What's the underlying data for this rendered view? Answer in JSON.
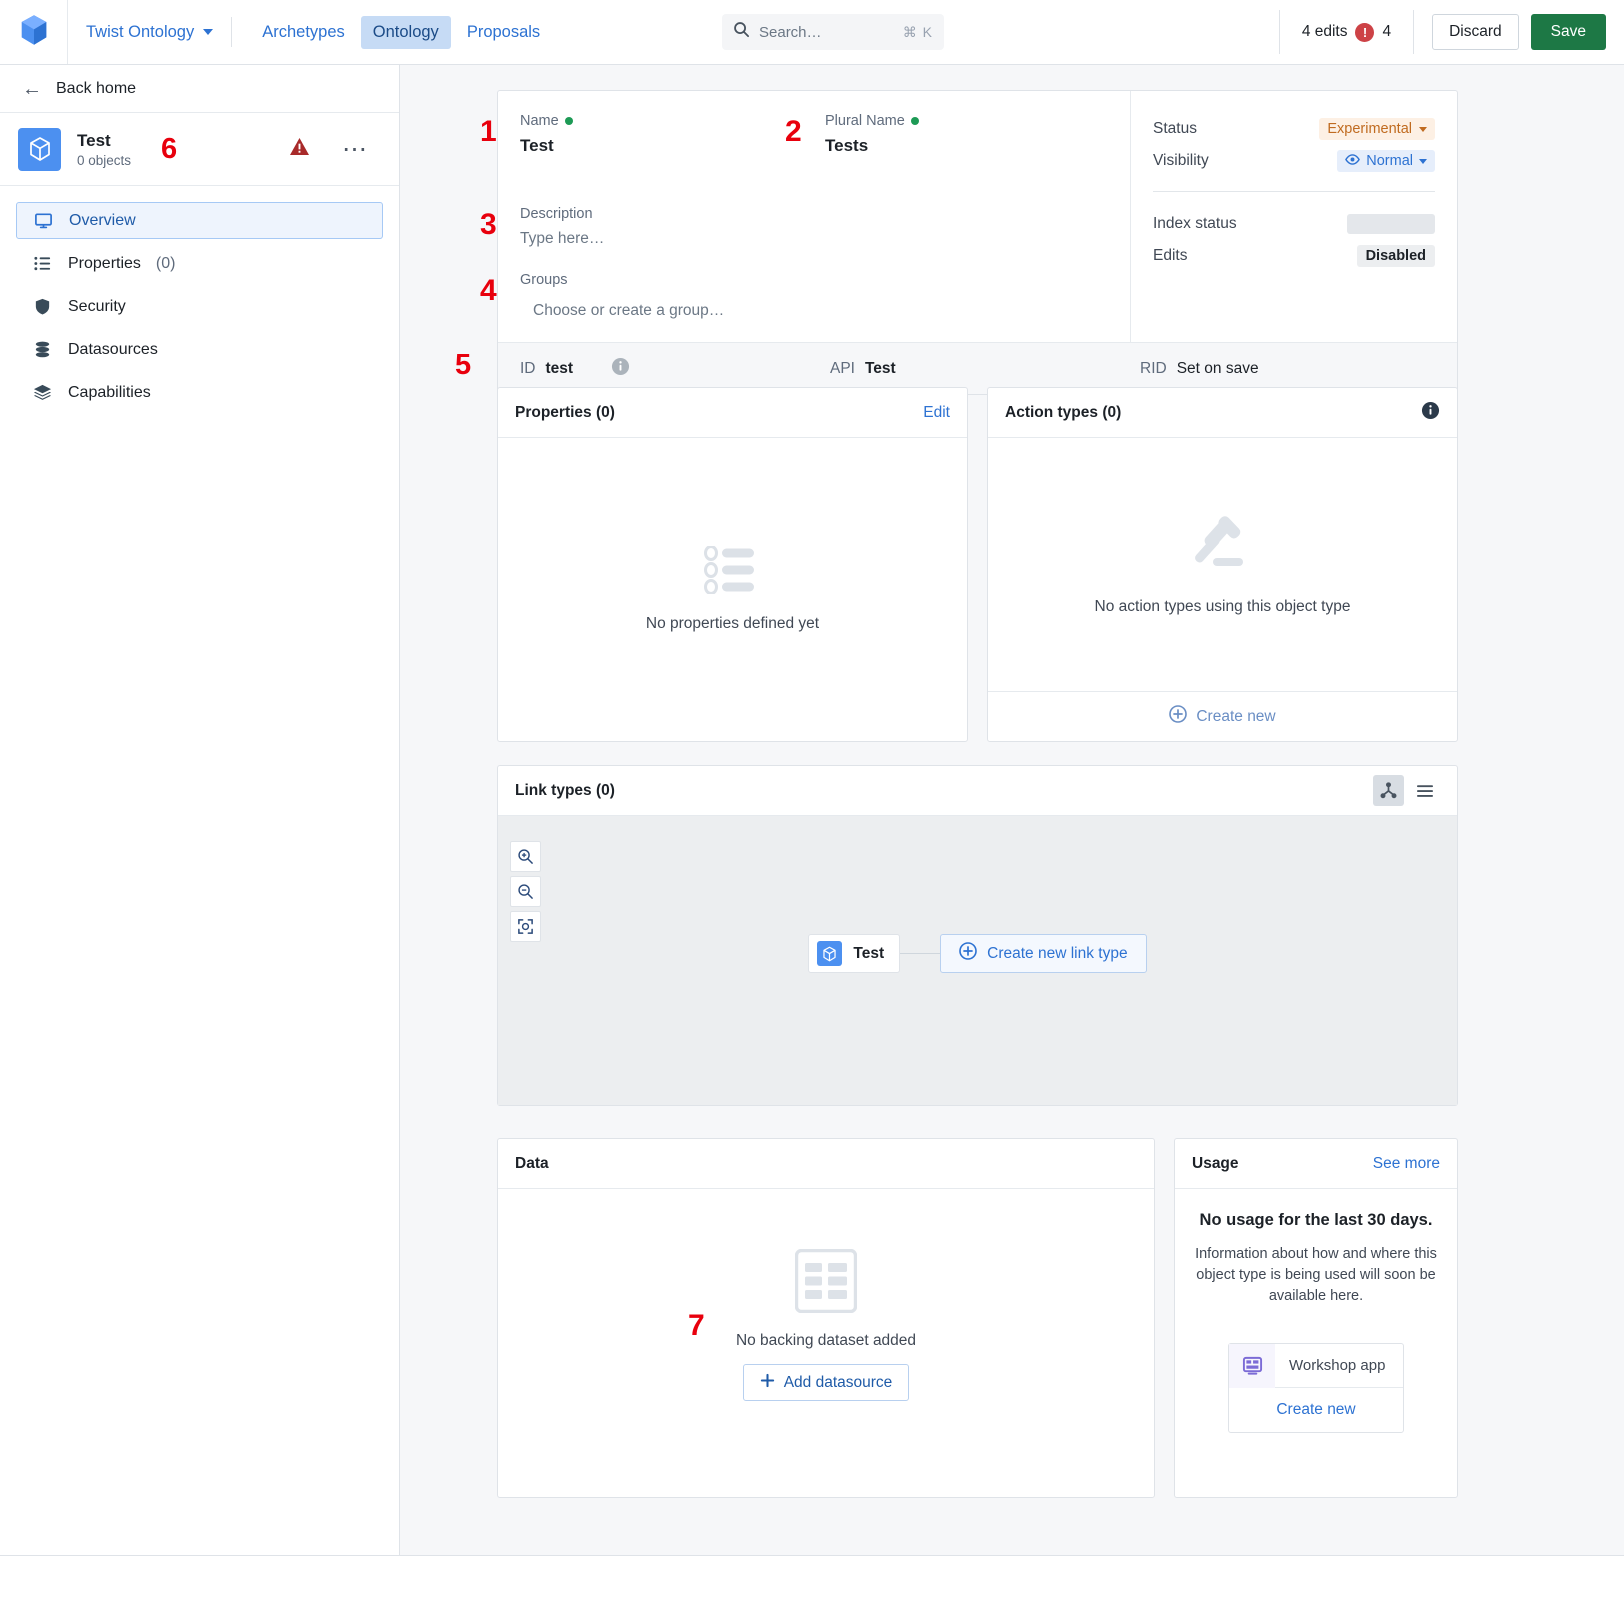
{
  "topbar": {
    "logo_icon": "cube-logo-icon",
    "workspace": "Twist Ontology",
    "nav": [
      {
        "label": "Archetypes",
        "active": false
      },
      {
        "label": "Ontology",
        "active": true
      },
      {
        "label": "Proposals",
        "active": false
      }
    ],
    "search": {
      "placeholder": "Search…",
      "shortcut": "⌘ K",
      "icon": "search-icon"
    },
    "edits_label": "4 edits",
    "error_badge": "!",
    "error_count": "4",
    "discard_label": "Discard",
    "save_label": "Save"
  },
  "sidebar": {
    "back_home": "Back home",
    "object": {
      "icon": "cube-icon",
      "title": "Test",
      "subtitle": "0 objects",
      "marker": "6",
      "warning_icon": "warning-triangle-icon",
      "more_icon": "more-options-icon"
    },
    "items": [
      {
        "label": "Overview",
        "count": "",
        "icon": "monitor-icon",
        "selected": true
      },
      {
        "label": "Properties",
        "count": " (0)",
        "icon": "list-icon",
        "selected": false
      },
      {
        "label": "Security",
        "count": "",
        "icon": "shield-icon",
        "selected": false
      },
      {
        "label": "Datasources",
        "count": "",
        "icon": "database-icon",
        "selected": false
      },
      {
        "label": "Capabilities",
        "count": "",
        "icon": "layers-icon",
        "selected": false
      }
    ]
  },
  "hero": {
    "markers": {
      "name": "1",
      "plural": "2",
      "description": "3",
      "groups": "4",
      "idrow": "5"
    },
    "name_label": "Name",
    "name_value": "Test",
    "plural_label": "Plural Name",
    "plural_value": "Tests",
    "description_label": "Description",
    "description_placeholder": "Type here…",
    "groups_label": "Groups",
    "groups_placeholder": "Choose or create a group…",
    "status_label": "Status",
    "status_value": "Experimental",
    "visibility_label": "Visibility",
    "visibility_value": "Normal",
    "visibility_icon": "eye-icon",
    "index_status_label": "Index status",
    "edits_label": "Edits",
    "edits_value": "Disabled",
    "id_key": "ID",
    "id_value": "test",
    "id_info_icon": "info-icon",
    "api_key": "API",
    "api_value": "Test",
    "rid_key": "RID",
    "rid_value": "Set on save"
  },
  "properties_card": {
    "title": "Properties (0)",
    "edit_label": "Edit",
    "empty_text": "No properties defined yet",
    "empty_icon": "property-list-icon"
  },
  "action_types_card": {
    "title": "Action types (0)",
    "info_icon": "info-icon",
    "empty_text": "No action types using this object type",
    "empty_icon": "gavel-icon",
    "create_label": "Create new",
    "create_icon": "plus-circle-icon"
  },
  "link_types_card": {
    "title": "Link types (0)",
    "graph_view_icon": "graph-view-icon",
    "list_view_icon": "list-view-icon",
    "zoom_in_icon": "zoom-in-icon",
    "zoom_out_icon": "zoom-out-icon",
    "fit_icon": "fit-to-screen-icon",
    "node_label": "Test",
    "node_icon": "cube-icon",
    "create_link_label": "Create new link type",
    "create_link_icon": "plus-circle-icon"
  },
  "data_card": {
    "title": "Data",
    "empty_icon": "table-icon",
    "empty_text": "No backing dataset added",
    "add_label": "Add datasource",
    "add_icon": "plus-icon",
    "marker": "7"
  },
  "usage_card": {
    "title": "Usage",
    "see_more_label": "See more",
    "headline": "No usage for the last 30 days.",
    "body": "Information about how and where this object type is being used will soon be available here.",
    "app_name": "Workshop app",
    "app_icon": "workshop-app-icon",
    "create_new_label": "Create new"
  },
  "colors": {
    "accent_blue": "#2d72d2",
    "save_green": "#1d7845",
    "error_red": "#cd4246",
    "marker_red": "#e8000d",
    "status_orange": "#c06b20",
    "panel_bg": "#f6f7f9"
  }
}
